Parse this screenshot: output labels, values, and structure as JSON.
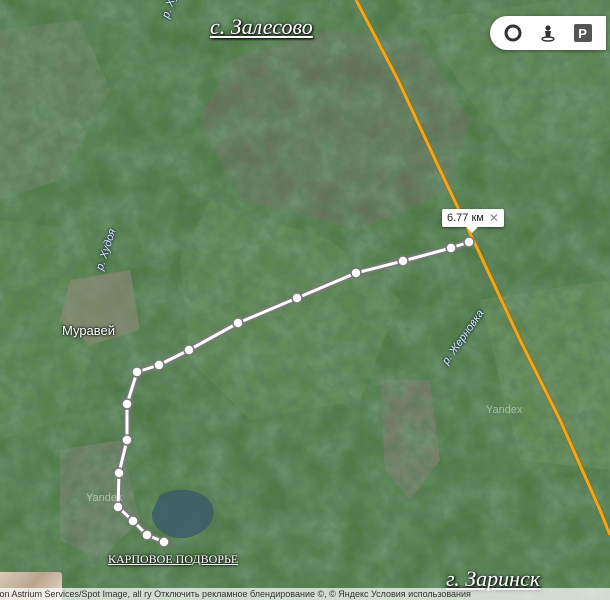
{
  "map": {
    "cities": {
      "top": "с. Залесово",
      "bottom": "г. Заринск"
    },
    "villages": [
      "Муравей"
    ],
    "rivers": [
      "р. Худоя",
      "р. Худоя",
      "р. Жерновка"
    ],
    "place": "КАРПОВОЕ ПОДВОРЬЕ",
    "watermarks": [
      "Yandex",
      "Yandex"
    ],
    "route": {
      "distance_label": "6.77 км",
      "close_icon": "close-icon"
    },
    "controls": [
      {
        "name": "layers-toggle",
        "icon": "circle-ring-icon"
      },
      {
        "name": "panorama-button",
        "icon": "pegman-icon"
      },
      {
        "name": "parking-button",
        "icon": "parking-icon",
        "label": "P"
      }
    ],
    "copyright": "ution Astrium Services/Spot Image, all rу Отключить рекламное блендирование  ©, © Яндекс  Условия использования"
  },
  "colors": {
    "highway": "#f2a71b",
    "route": "#ffffff",
    "route_outline": "#7a7a7a"
  }
}
